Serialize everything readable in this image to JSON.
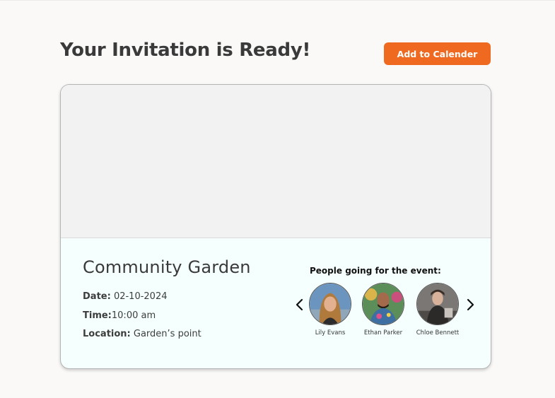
{
  "header": {
    "title": "Your Invitation is Ready!",
    "add_calendar_label": "Add to Calender"
  },
  "event": {
    "name": "Community Garden",
    "date_label": "Date:",
    "date_value": "02-10-2024",
    "time_label": "Time:",
    "time_value": "10:00 am",
    "location_label": "Location:",
    "location_value": "Garden’s point"
  },
  "attendees": {
    "title": "People going for the event:",
    "people": [
      {
        "name": "Lily Evans"
      },
      {
        "name": "Ethan Parker"
      },
      {
        "name": "Chloe Bennett"
      }
    ]
  },
  "icons": {
    "prev": "chevron-left-icon",
    "next": "chevron-right-icon"
  },
  "colors": {
    "accent": "#ef6a20",
    "page_bg": "#faf9f7",
    "card_info_bg": "#f5fffe",
    "banner_bg": "#f2f2f2"
  }
}
